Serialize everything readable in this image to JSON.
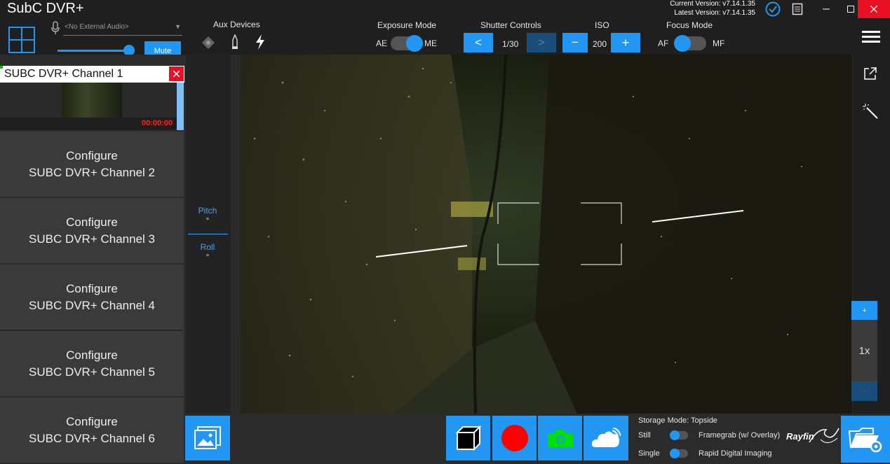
{
  "app": {
    "title": "SubC DVR+",
    "current_version": "Current Version: v7.14.1.35",
    "latest_version": "Latest Version: v7.14.1.35"
  },
  "audio": {
    "placeholder": "<No External Audio>",
    "mute_label": "Mute",
    "volume_level": 1.0
  },
  "aux": {
    "label": "Aux Devices"
  },
  "exposure": {
    "label": "Exposure Mode",
    "left": "AE",
    "right": "ME"
  },
  "shutter": {
    "label": "Shutter Controls",
    "prev": "<",
    "value": "1/30",
    "next": ">"
  },
  "iso": {
    "label": "ISO",
    "minus": "−",
    "value": "200",
    "plus": "+"
  },
  "focus": {
    "label": "Focus Mode",
    "left": "AF",
    "right": "MF"
  },
  "channels": {
    "active": {
      "name": "SUBC DVR+ Channel 1",
      "timer": "00:00:00"
    },
    "c2": {
      "line1": "Configure",
      "line2": "SUBC DVR+ Channel 2"
    },
    "c3": {
      "line1": "Configure",
      "line2": "SUBC DVR+ Channel 3"
    },
    "c4": {
      "line1": "Configure",
      "line2": "SUBC DVR+ Channel 4"
    },
    "c5": {
      "line1": "Configure",
      "line2": "SUBC DVR+ Channel 5"
    },
    "c6": {
      "line1": "Configure",
      "line2": "SUBC DVR+ Channel 6"
    }
  },
  "telemetry": {
    "pitch_label": "Pitch",
    "pitch_value": "°",
    "roll_label": "Roll",
    "roll_value": "°"
  },
  "zoom": {
    "plus": "+",
    "value": "1x",
    "minus": "-"
  },
  "storage": {
    "mode": "Storage Mode: Topside",
    "still": "Still",
    "framegrab": "Framegrab (w/ Overlay)",
    "single": "Single",
    "rapid": "Rapid Digital Imaging"
  },
  "brand": {
    "logo_text": "Rayfin"
  },
  "colors": {
    "accent": "#2196f3",
    "record": "#ff0000",
    "snapshot": "#00e000",
    "close": "#e81123"
  }
}
